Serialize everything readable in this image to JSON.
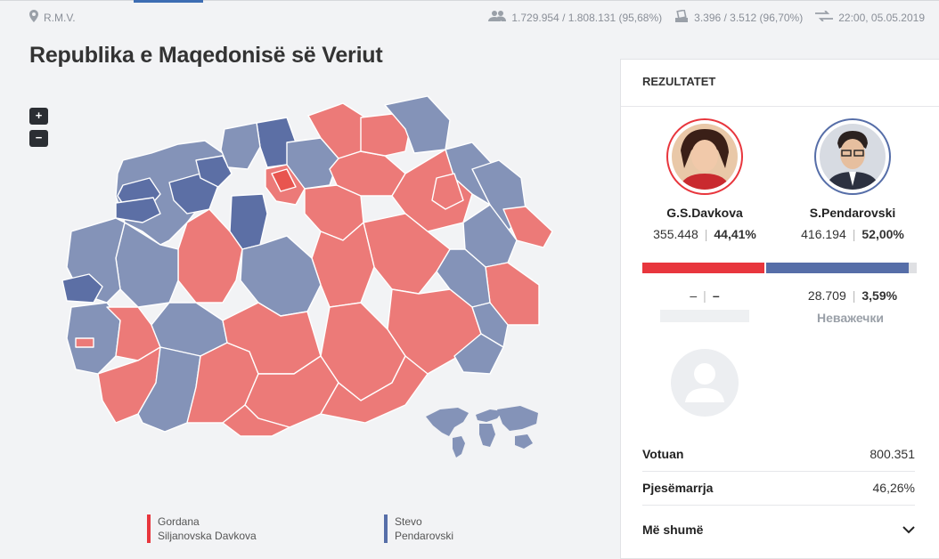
{
  "header": {
    "region": "R.M.V.",
    "voters": "1.729.954 / 1.808.131 (95,68%)",
    "stations": "3.396 / 3.512 (96,70%)",
    "updated": "22:00, 05.05.2019"
  },
  "title": "Republika e Maqedonisë së Veriut",
  "zoom": {
    "in": "+",
    "out": "−"
  },
  "colors": {
    "davkova": "#e8363d",
    "pendarovski": "#566ea8",
    "davkova_map": "#ec7a78",
    "pendarovski_map": "#8493b8"
  },
  "legend": [
    {
      "line1": "Gordana",
      "line2": "Siljanovska Davkova",
      "color": "#e8363d"
    },
    {
      "line1": "Stevo",
      "line2": "Pendarovski",
      "color": "#566ea8"
    }
  ],
  "results": {
    "heading": "REZULTATET",
    "candidates": [
      {
        "name": "G.S.Davkova",
        "votes": "355.448",
        "percent": "44,41%",
        "share": 0.4441,
        "color": "#e8363d"
      },
      {
        "name": "S.Pendarovski",
        "votes": "416.194",
        "percent": "52,00%",
        "share": 0.52,
        "color": "#566ea8"
      }
    ],
    "third": {
      "votes": "–",
      "percent": "–"
    },
    "invalid": {
      "votes": "28.709",
      "percent": "3,59%",
      "label": "Неважечки"
    },
    "details": [
      {
        "key": "Votuan",
        "value": "800.351"
      },
      {
        "key": "Pjesëmarrja",
        "value": "46,26%"
      }
    ],
    "more": "Më shumë"
  }
}
